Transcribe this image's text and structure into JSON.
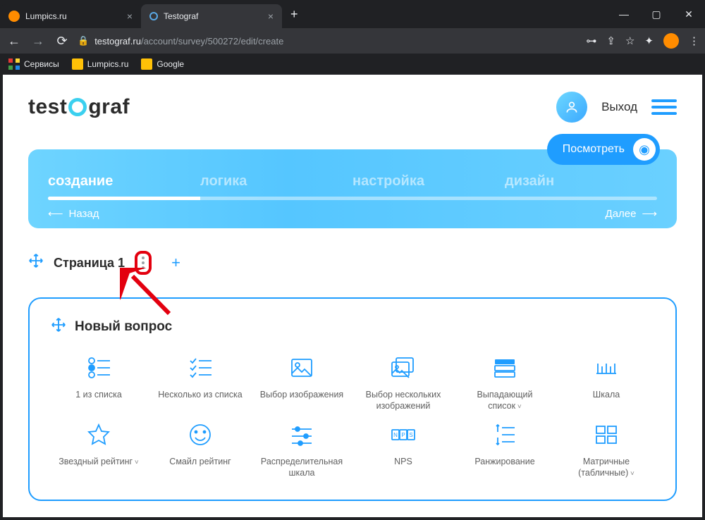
{
  "browser": {
    "tabs": [
      {
        "title": "Lumpics.ru",
        "active": false
      },
      {
        "title": "Testograf",
        "active": true
      }
    ],
    "url_host": "testograf.ru",
    "url_path": "/account/survey/500272/edit/create",
    "bookmarks": [
      "Сервисы",
      "Lumpics.ru",
      "Google"
    ]
  },
  "header": {
    "logo_pre": "test",
    "logo_post": "graf",
    "exit": "Выход"
  },
  "banner": {
    "preview": "Посмотреть",
    "steps": [
      "создание",
      "логика",
      "настройка",
      "дизайн"
    ],
    "active_step": 0,
    "back": "Назад",
    "next": "Далее"
  },
  "page_section": {
    "title": "Страница 1"
  },
  "question_card": {
    "title": "Новый вопрос",
    "types": [
      {
        "label": "1 из списка",
        "chev": false
      },
      {
        "label": "Несколько из списка",
        "chev": false
      },
      {
        "label": "Выбор изображения",
        "chev": false
      },
      {
        "label": "Выбор нескольких изображений",
        "chev": false
      },
      {
        "label": "Выпадающий список",
        "chev": true
      },
      {
        "label": "Шкала",
        "chev": false
      },
      {
        "label": "Звездный рейтинг",
        "chev": true
      },
      {
        "label": "Смайл рейтинг",
        "chev": false
      },
      {
        "label": "Распределительная шкала",
        "chev": false
      },
      {
        "label": "NPS",
        "chev": false
      },
      {
        "label": "Ранжирование",
        "chev": false
      },
      {
        "label": "Матричные (табличные)",
        "chev": true
      }
    ]
  }
}
